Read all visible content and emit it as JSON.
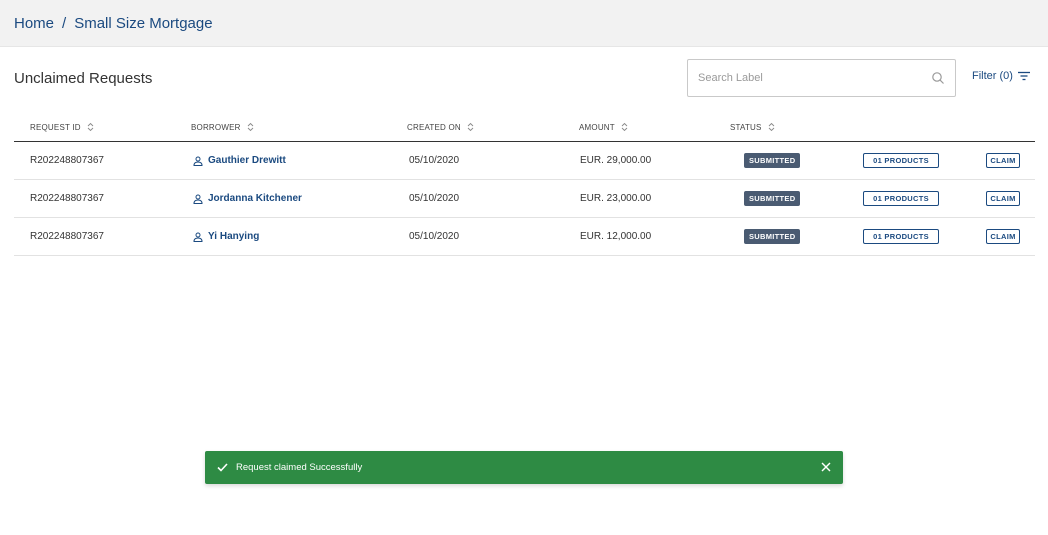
{
  "breadcrumb": {
    "home": "Home",
    "separator": "/",
    "current": "Small Size Mortgage"
  },
  "section_title": "Unclaimed Requests",
  "search": {
    "placeholder": "Search Label",
    "icon": "search-icon"
  },
  "filter": {
    "label": "Filter (0)",
    "icon": "filter-icon"
  },
  "table": {
    "columns": [
      "REQUEST ID",
      "BORROWER",
      "CREATED ON",
      "AMOUNT",
      "STATUS"
    ],
    "rows": [
      {
        "request_id": "R202248807367",
        "borrower": "Gauthier Drewitt",
        "created_on": "05/10/2020",
        "amount": "EUR. 29,000.00",
        "status": "SUBMITTED",
        "products": "01 PRODUCTS",
        "action": "CLAIM"
      },
      {
        "request_id": "R202248807367",
        "borrower": "Jordanna Kitchener",
        "created_on": "05/10/2020",
        "amount": "EUR. 23,000.00",
        "status": "SUBMITTED",
        "products": "01 PRODUCTS",
        "action": "CLAIM"
      },
      {
        "request_id": "R202248807367",
        "borrower": "Yi Hanying",
        "created_on": "05/10/2020",
        "amount": "EUR. 12,000.00",
        "status": "SUBMITTED",
        "products": "01 PRODUCTS",
        "action": "CLAIM"
      }
    ]
  },
  "toast": {
    "message": "Request claimed Successfully",
    "color": "#2e8b44"
  },
  "colors": {
    "brand": "#1b4a80",
    "status_badge": "#4a5b72",
    "topbar": "#f2f2f2"
  }
}
